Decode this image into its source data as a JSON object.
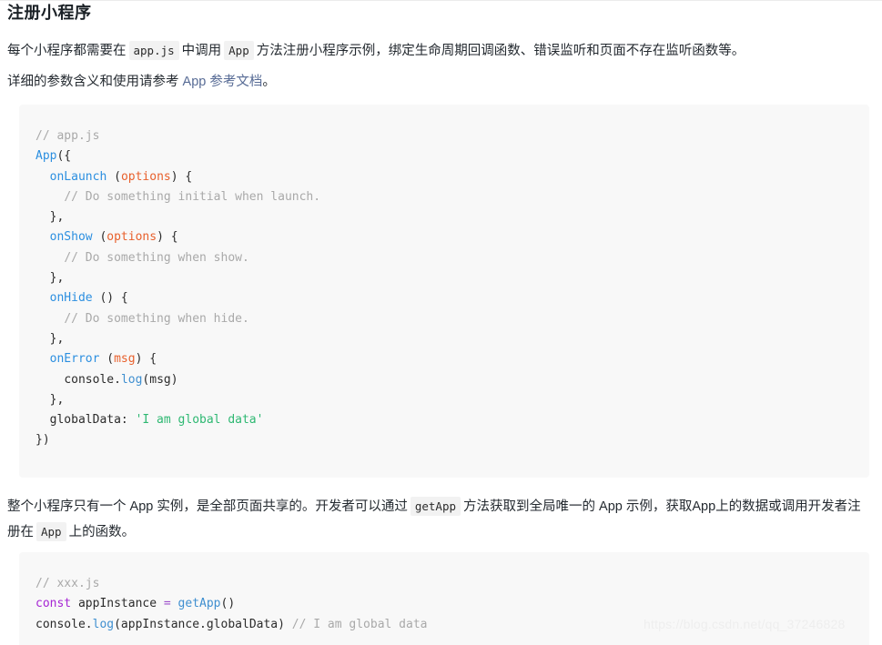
{
  "page": {
    "title": "注册小程序",
    "watermark": "https://blog.csdn.net/qq_37246828"
  },
  "paragraph_1": {
    "part_1": "每个小程序都需要在",
    "code_1": "app.js",
    "part_2": "中调用",
    "code_2": "App",
    "part_3": "方法注册小程序示例，绑定生命周期回调函数、错误监听和页面不存在监听函数等。"
  },
  "paragraph_2": {
    "part_1": "详细的参数含义和使用请参考",
    "link_label": "App 参考文档",
    "part_2": "。"
  },
  "paragraph_3": {
    "part_1": "整个小程序只有一个 App 实例，是全部页面共享的。开发者可以通过",
    "code_1": "getApp",
    "part_2": "方法获取到全局唯一的 App 示例，获取App上的数据或调用开发者注册在",
    "code_2": "App",
    "part_3": "上的函数。"
  },
  "code_block_1": {
    "language": "javascript",
    "lines": [
      "// app.js",
      "App({",
      "  onLaunch (options) {",
      "    // Do something initial when launch.",
      "  },",
      "  onShow (options) {",
      "    // Do something when show.",
      "  },",
      "  onHide () {",
      "    // Do something when hide.",
      "  },",
      "  onError (msg) {",
      "    console.log(msg)",
      "  },",
      "  globalData: 'I am global data'",
      "})"
    ]
  },
  "code_block_2": {
    "language": "javascript",
    "lines": [
      "// xxx.js",
      "const appInstance = getApp()",
      "console.log(appInstance.globalData) // I am global data"
    ]
  },
  "colors": {
    "comment": "#a9a9a9",
    "function": "#3f8fd0",
    "parameter": "#e8602c",
    "string": "#2eb872",
    "keyword": "#a626d4",
    "link": "#576b95",
    "code_background": "#f8f8f8",
    "inline_code_background": "#f2f2f2"
  }
}
